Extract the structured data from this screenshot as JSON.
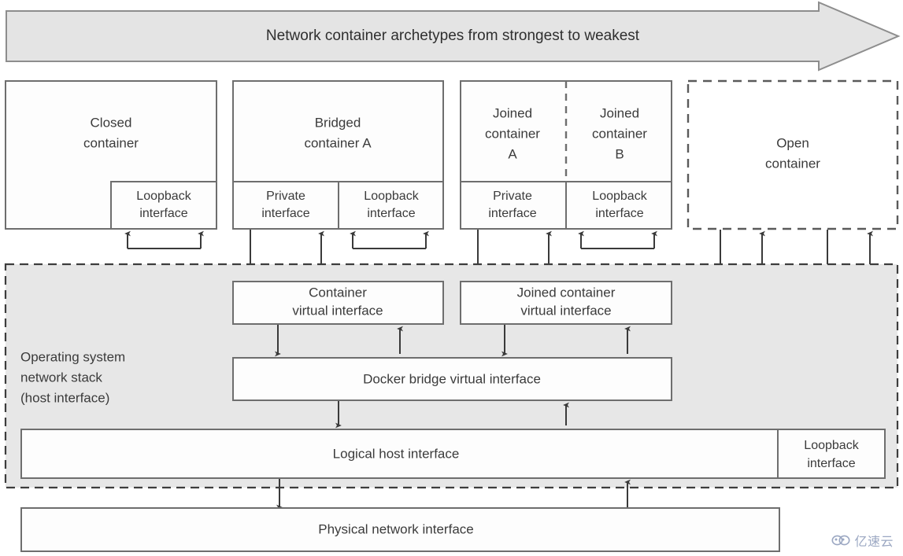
{
  "banner": {
    "label": "Network container archetypes from strongest to weakest",
    "fill": "#e4e4e4",
    "stroke": "#8d8d8d"
  },
  "containers": [
    {
      "id": "closed",
      "title": "Closed container",
      "title_lines": [
        "Closed",
        "container"
      ],
      "border": "solid",
      "interfaces": [
        "Loopback interface"
      ]
    },
    {
      "id": "bridged",
      "title": "Bridged container A",
      "title_lines": [
        "Bridged",
        "container A"
      ],
      "border": "solid",
      "interfaces": [
        "Private interface",
        "Loopback interface"
      ]
    },
    {
      "id": "joined",
      "title": "Joined containers",
      "title_lines_a": [
        "Joined",
        "container",
        "A"
      ],
      "title_lines_b": [
        "Joined",
        "container",
        "B"
      ],
      "border": "solid",
      "divider": "dashed",
      "interfaces": [
        "Private interface",
        "Loopback interface"
      ]
    },
    {
      "id": "open",
      "title": "Open container",
      "title_lines": [
        "Open",
        "container"
      ],
      "border": "dashed",
      "interfaces": []
    }
  ],
  "interface_labels": {
    "loopback_l1": "Loopback",
    "loopback_l2": "interface",
    "private_l1": "Private",
    "private_l2": "interface"
  },
  "stack": {
    "label_lines": [
      "Operating system",
      "network stack",
      "(host interface)"
    ],
    "fill": "#e7e7e7",
    "boxes": [
      {
        "id": "container-vif",
        "lines": [
          "Container",
          "virtual interface"
        ]
      },
      {
        "id": "joined-container-vif",
        "lines": [
          "Joined container",
          "virtual interface"
        ]
      },
      {
        "id": "docker-bridge-vif",
        "lines": [
          "Docker bridge virtual interface"
        ]
      },
      {
        "id": "logical-host-interface",
        "lines": [
          "Logical host interface"
        ]
      },
      {
        "id": "host-loopback",
        "lines": [
          "Loopback",
          "interface"
        ]
      }
    ]
  },
  "physical": {
    "label": "Physical network interface"
  },
  "watermark": {
    "text": "亿速云"
  },
  "colors": {
    "line": "#3a3a3a",
    "box_stroke": "#6e6e6e",
    "text": "#3b3b3b",
    "page_bg": "#ffffff"
  }
}
